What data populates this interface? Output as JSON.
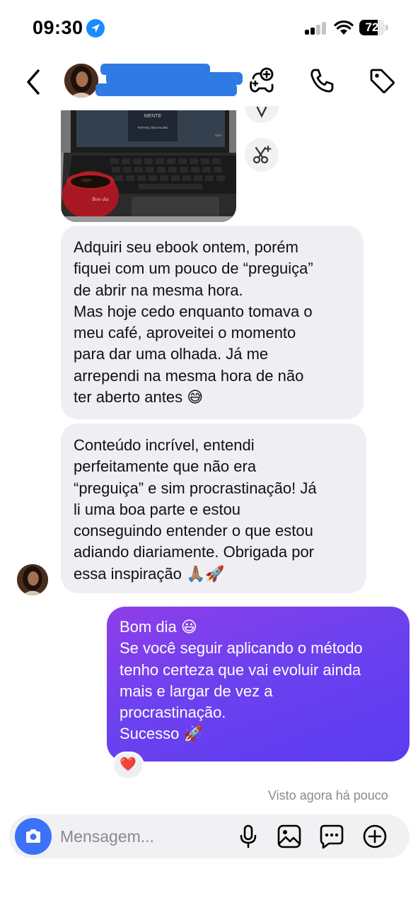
{
  "status_bar": {
    "time": "09:30",
    "battery": "72",
    "battery_level": 0.72
  },
  "header": {
    "contact_name_redacted": true,
    "icons": [
      "back-icon",
      "avatar",
      "game-controller-plus-icon",
      "phone-icon",
      "tag-icon"
    ]
  },
  "chat": {
    "side_buttons": [
      "share-icon",
      "scissors-sparkle-icon"
    ],
    "messages": [
      {
        "direction": "in",
        "lines": [
          "Adquiri seu ebook ontem, porém",
          "fiquei com um pouco de “preguiça”",
          "de abrir na mesma hora.",
          "Mas hoje cedo enquanto tomava o",
          "meu café, aproveitei o momento",
          "para dar uma olhada. Já me",
          "arrependi na mesma hora de não",
          "ter aberto antes 😅"
        ]
      },
      {
        "direction": "in",
        "lines": [
          "Conteúdo incrível, entendi",
          "perfeitamente que não era",
          "“preguiça” e sim procrastinação! Já",
          "li uma boa parte e estou",
          "conseguindo entender o que estou",
          "adiando diariamente. Obrigada por",
          "essa inspiração 🙏🏽🚀"
        ]
      },
      {
        "direction": "out",
        "lines": [
          "Bom dia 😃",
          "Se você seguir aplicando o método",
          "tenho certeza que vai evoluir ainda",
          "mais e largar de vez a",
          "procrastinação.",
          "Sucesso 🚀"
        ],
        "reaction": "❤️"
      }
    ],
    "seen_status": "Visto agora há pouco"
  },
  "composer": {
    "placeholder": "Mensagem...",
    "icons": [
      "camera-icon",
      "microphone-icon",
      "gallery-icon",
      "sticker-chat-icon",
      "plus-icon"
    ]
  },
  "colors": {
    "accent": "#3c72f7",
    "outgoing_start": "#8e3ee9",
    "outgoing_end": "#5b3cf2",
    "incoming_bg": "#efeff3"
  }
}
